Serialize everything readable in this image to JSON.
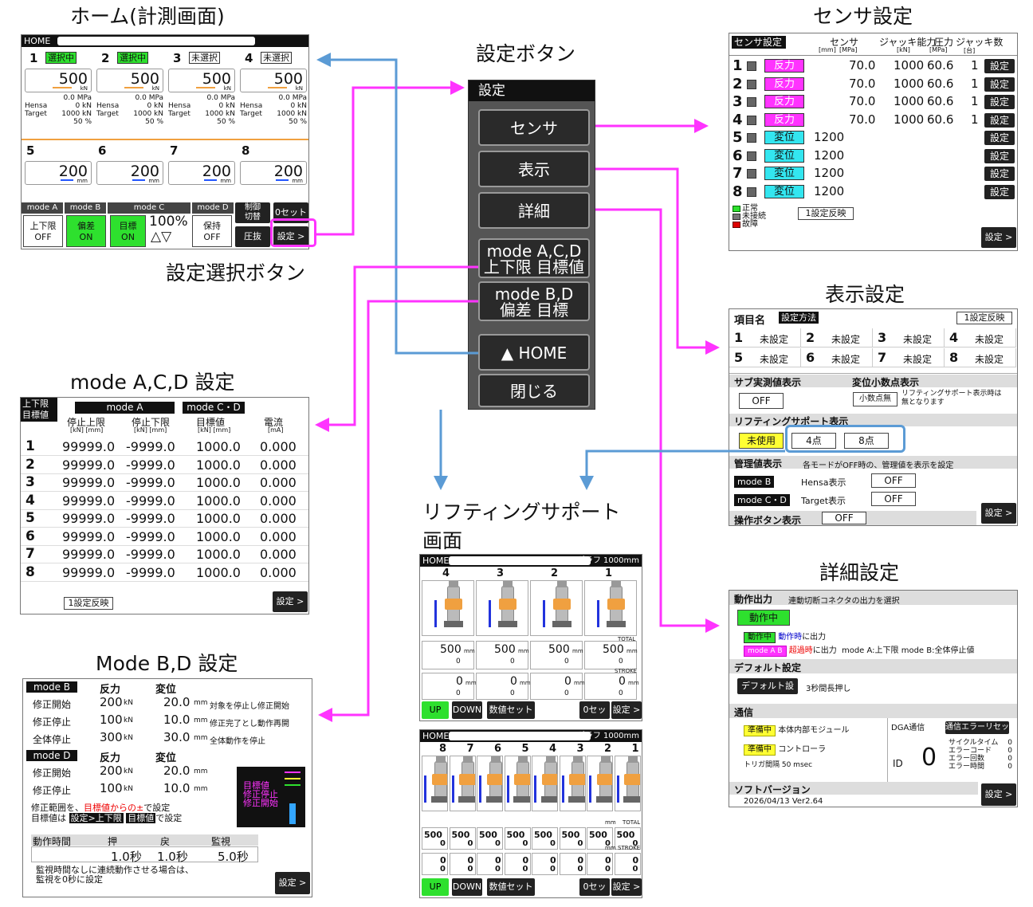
{
  "titles": {
    "home": "ホーム(計測画面)",
    "settings_button": "設定ボタン",
    "select_button": "設定選択ボタン",
    "sensor": "センサ設定",
    "display": "表示設定",
    "mode_acd": "mode A,C,D 設定",
    "mode_bd": "Mode B,D 設定",
    "lifting": "リフティングサポート\n画面",
    "lifting_l1": "リフティングサポート",
    "lifting_l2": "画面",
    "detail": "詳細設定"
  },
  "home": {
    "bar": "HOME",
    "channels": [
      {
        "num": "1",
        "state": "選択中",
        "value": "500",
        "unit": "kN",
        "mpa": "0.0 MPa",
        "hensa": "Hensa",
        "hensa_val": "0 kN",
        "target": "Target",
        "target_val": "1000 kN",
        "pct": "50 %"
      },
      {
        "num": "2",
        "state": "選択中",
        "value": "500",
        "unit": "kN",
        "mpa": "0.0 MPa",
        "hensa": "Hensa",
        "hensa_val": "0 kN",
        "target": "Target",
        "target_val": "1000 kN",
        "pct": "50 %"
      },
      {
        "num": "3",
        "state": "未選択",
        "value": "500",
        "unit": "kN",
        "mpa": "0.0 MPa",
        "hensa": "Hensa",
        "hensa_val": "0 kN",
        "target": "Target",
        "target_val": "1000 kN",
        "pct": "50 %"
      },
      {
        "num": "4",
        "state": "未選択",
        "value": "500",
        "unit": "kN",
        "mpa": "0.0 MPa",
        "hensa": "Hensa",
        "hensa_val": "0 kN",
        "target": "Target",
        "target_val": "1000 kN",
        "pct": "50 %"
      }
    ],
    "channels2": [
      {
        "num": "5",
        "value": "200",
        "unit": "mm"
      },
      {
        "num": "6",
        "value": "200",
        "unit": "mm"
      },
      {
        "num": "7",
        "value": "200",
        "unit": "mm"
      },
      {
        "num": "8",
        "value": "200",
        "unit": "mm"
      }
    ],
    "modes": [
      "mode A",
      "mode B",
      "mode C",
      "mode D"
    ],
    "btn_updown": "上下限",
    "btn_updown_state": "OFF",
    "btn_hensa": "偏差",
    "btn_hensa_state": "ON",
    "btn_target": "目標",
    "btn_target_state": "ON",
    "pct": "100%",
    "tri": "△▽",
    "btn_hold": "保持",
    "btn_hold_state": "OFF",
    "btn_ctrl": "制御\n切替",
    "btn_ctrl_l1": "制御",
    "btn_ctrl_l2": "切替",
    "btn_zero": "0セット",
    "btn_press": "圧抜",
    "btn_setting": "設定 >"
  },
  "menu": {
    "title": "設定",
    "items": [
      "センサ",
      "表示",
      "詳細"
    ],
    "mode_acd_l1": "mode A,C,D",
    "mode_acd_l2": "上下限 目標値",
    "mode_bd_l1": "mode B,D",
    "mode_bd_l2": "偏差 目標",
    "home": "HOME",
    "close": "閉じる"
  },
  "sensor": {
    "header": "センサ設定",
    "cols": [
      "センサ",
      "ジャッキ能力",
      "圧力",
      "ジャッキ数"
    ],
    "units": [
      "[mm]",
      "[MPa]",
      "[kN]",
      "[MPa]",
      "[台]"
    ],
    "rows": [
      {
        "n": "1",
        "type": "反力",
        "v1": "70.0",
        "v2": "1000",
        "v3": "60.6",
        "v4": "1",
        "btn": "設定"
      },
      {
        "n": "2",
        "type": "反力",
        "v1": "70.0",
        "v2": "1000",
        "v3": "60.6",
        "v4": "1",
        "btn": "設定"
      },
      {
        "n": "3",
        "type": "反力",
        "v1": "70.0",
        "v2": "1000",
        "v3": "60.6",
        "v4": "1",
        "btn": "設定"
      },
      {
        "n": "4",
        "type": "反力",
        "v1": "70.0",
        "v2": "1000",
        "v3": "60.6",
        "v4": "1",
        "btn": "設定"
      },
      {
        "n": "5",
        "type": "変位",
        "v1": "1200",
        "v2": "",
        "v3": "",
        "v4": "",
        "btn": "設定"
      },
      {
        "n": "6",
        "type": "変位",
        "v1": "1200",
        "v2": "",
        "v3": "",
        "v4": "",
        "btn": "設定"
      },
      {
        "n": "7",
        "type": "変位",
        "v1": "1200",
        "v2": "",
        "v3": "",
        "v4": "",
        "btn": "設定"
      },
      {
        "n": "8",
        "type": "変位",
        "v1": "1200",
        "v2": "",
        "v3": "",
        "v4": "",
        "btn": "設定"
      }
    ],
    "legend": [
      "正常",
      "未接続",
      "故障"
    ],
    "reflect": "1設定反映",
    "setting": "設定 >"
  },
  "display": {
    "item_name": "項目名",
    "method": "設定方法",
    "reflect": "1設定反映",
    "items": [
      {
        "n": "1",
        "v": "未設定"
      },
      {
        "n": "2",
        "v": "未設定"
      },
      {
        "n": "3",
        "v": "未設定"
      },
      {
        "n": "4",
        "v": "未設定"
      },
      {
        "n": "5",
        "v": "未設定"
      },
      {
        "n": "6",
        "v": "未設定"
      },
      {
        "n": "7",
        "v": "未設定"
      },
      {
        "n": "8",
        "v": "未設定"
      }
    ],
    "sub_label": "サブ実測値表示",
    "sub_val": "OFF",
    "dec_label": "変位小数点表示",
    "dec_val": "小数点無",
    "dec_note1": "リフティングサポート表示時は",
    "dec_note2": "無となります",
    "lift_label": "リフティングサポート表示",
    "lift_opts": [
      "未使用",
      "4点",
      "8点"
    ],
    "mgmt_label": "管理値表示",
    "mgmt_note": "各モードがOFF時の、管理値を表示を設定",
    "mgmt_b": "mode B",
    "mgmt_b_text": "Hensa表示",
    "mgmt_b_val": "OFF",
    "mgmt_cd": "mode C・D",
    "mgmt_cd_text": "Target表示",
    "mgmt_cd_val": "OFF",
    "op_label": "操作ボタン表示",
    "op_val": "OFF",
    "setting": "設定 >"
  },
  "mode_acd": {
    "corner1": "上下限",
    "corner2": "目標値",
    "mode_a": "mode A",
    "mode_cd": "mode C・D",
    "cols": [
      "停止上限",
      "停止下限",
      "目標値",
      "電流"
    ],
    "units": [
      "[kN] [mm]",
      "[kN] [mm]",
      "[kN] [mm]",
      "[mA]"
    ],
    "rows": [
      {
        "n": "1",
        "a": "99999.0",
        "b": "-9999.0",
        "c": "1000.0",
        "d": "0.000"
      },
      {
        "n": "2",
        "a": "99999.0",
        "b": "-9999.0",
        "c": "1000.0",
        "d": "0.000"
      },
      {
        "n": "3",
        "a": "99999.0",
        "b": "-9999.0",
        "c": "1000.0",
        "d": "0.000"
      },
      {
        "n": "4",
        "a": "99999.0",
        "b": "-9999.0",
        "c": "1000.0",
        "d": "0.000"
      },
      {
        "n": "5",
        "a": "99999.0",
        "b": "-9999.0",
        "c": "1000.0",
        "d": "0.000"
      },
      {
        "n": "6",
        "a": "99999.0",
        "b": "-9999.0",
        "c": "1000.0",
        "d": "0.000"
      },
      {
        "n": "7",
        "a": "99999.0",
        "b": "-9999.0",
        "c": "1000.0",
        "d": "0.000"
      },
      {
        "n": "8",
        "a": "99999.0",
        "b": "-9999.0",
        "c": "1000.0",
        "d": "0.000"
      }
    ],
    "reflect": "1設定反映",
    "setting": "設定 >"
  },
  "mode_bd": {
    "mode_b": "mode B",
    "col_force": "反力",
    "col_disp": "変位",
    "b_rows": [
      {
        "label": "修正開始",
        "f": "200",
        "fu": "kN",
        "d": "20.0",
        "du": "mm",
        "note": "対象を停止し修正開始"
      },
      {
        "label": "修正停止",
        "f": "100",
        "fu": "kN",
        "d": "10.0",
        "du": "mm",
        "note": "修正完了とし動作再開"
      },
      {
        "label": "全体停止",
        "f": "300",
        "fu": "kN",
        "d": "30.0",
        "du": "mm",
        "note": "全体動作を停止"
      }
    ],
    "mode_d": "mode D",
    "d_rows": [
      {
        "label": "修正開始",
        "f": "200",
        "fu": "kN",
        "d": "20.0",
        "du": "mm"
      },
      {
        "label": "修正停止",
        "f": "100",
        "fu": "kN",
        "d": "10.0",
        "du": "mm"
      }
    ],
    "legend": [
      "目標値",
      "修正停止",
      "修正開始"
    ],
    "note1_a": "修正範囲を、",
    "note1_b": "目標値からの±",
    "note1_c": "で設定",
    "note2_a": "目標値は",
    "note2_b": "設定>上下限",
    "note2_c": "目標値",
    "note2_d": "で設定",
    "time_label": "動作時間",
    "time_cols": [
      "押",
      "戻",
      "監視"
    ],
    "time_vals": [
      "1.0秒",
      "1.0秒",
      "5.0秒"
    ],
    "foot1": "監視時間なしに連続動作させる場合は、",
    "foot2": "監視を0秒に設定",
    "setting": "設定 >"
  },
  "lift4": {
    "bar": "HOME",
    "graph": "グラフ 1000mm",
    "nums": [
      "4",
      "3",
      "2",
      "1"
    ],
    "vals": [
      "500",
      "500",
      "500",
      "500"
    ],
    "unit": "mm",
    "subs": [
      "0",
      "0",
      "0",
      "0"
    ],
    "total": "TOTAL",
    "stroke": "STROKE",
    "vals2": [
      "0",
      "0",
      "0",
      "0"
    ],
    "subs2": [
      "0",
      "0",
      "0",
      "0"
    ],
    "up": "UP",
    "down": "DOWN",
    "numset": "数値セット",
    "zero": "0セット",
    "setting": "設定 >"
  },
  "lift8": {
    "bar": "HOME",
    "graph": "グラフ 1000mm",
    "nums": [
      "8",
      "7",
      "6",
      "5",
      "4",
      "3",
      "2",
      "1"
    ],
    "vals": [
      "500",
      "500",
      "500",
      "500",
      "500",
      "500",
      "500",
      "500"
    ],
    "subs": [
      "0",
      "0",
      "0",
      "0",
      "0",
      "0",
      "0",
      "0"
    ],
    "vals2": [
      "0",
      "0",
      "0",
      "0",
      "0",
      "0",
      "0",
      "0"
    ],
    "subs2": [
      "0",
      "0",
      "0",
      "0",
      "0",
      "0",
      "0",
      "0"
    ],
    "mm": "mm",
    "total": "TOTAL",
    "stroke": "STROKE",
    "up": "UP",
    "down": "DOWN",
    "numset": "数値セット",
    "zero": "0セット",
    "setting": "設定 >"
  },
  "detail": {
    "out_label": "動作出力",
    "out_note": "連動切断コネクタの出力を選択",
    "out_btn": "動作中",
    "l1_badge": "動作中",
    "l1_blue": "動作時",
    "l1_text": "に出力",
    "l2_badge": "mode A B",
    "l2_red": "超過時",
    "l2_text": "に出力",
    "l2_note": "mode A:上下限 mode B:全体停止値",
    "def_label": "デフォルト設定",
    "def_btn": "デフォルト設定",
    "def_note": "3秒間長押し",
    "comm_label": "通信",
    "comm1_badge": "準備中",
    "comm1_text": "本体内部モジュール",
    "comm2_badge": "準備中",
    "comm2_text": "コントローラ",
    "trig": "トリガ間隔 50 msec",
    "dga": "DGA通信",
    "err_reset": "通信エラーリセット",
    "id": "ID",
    "id_val": "0",
    "stats": [
      {
        "k": "サイクルタイム",
        "v": "0"
      },
      {
        "k": "エラーコード",
        "v": "0"
      },
      {
        "k": "エラー回数",
        "v": "0"
      },
      {
        "k": "エラー時間",
        "v": "0"
      }
    ],
    "soft_label": "ソフトバージョン",
    "soft_val": "2026/04/13 Ver2.64",
    "setting": "設定 >"
  },
  "colors": {
    "magenta": "#ff33ff",
    "blue": "#5b9bd5",
    "green": "#2ee02e",
    "cyan": "#33e6f0",
    "yellow": "#ffff33"
  }
}
